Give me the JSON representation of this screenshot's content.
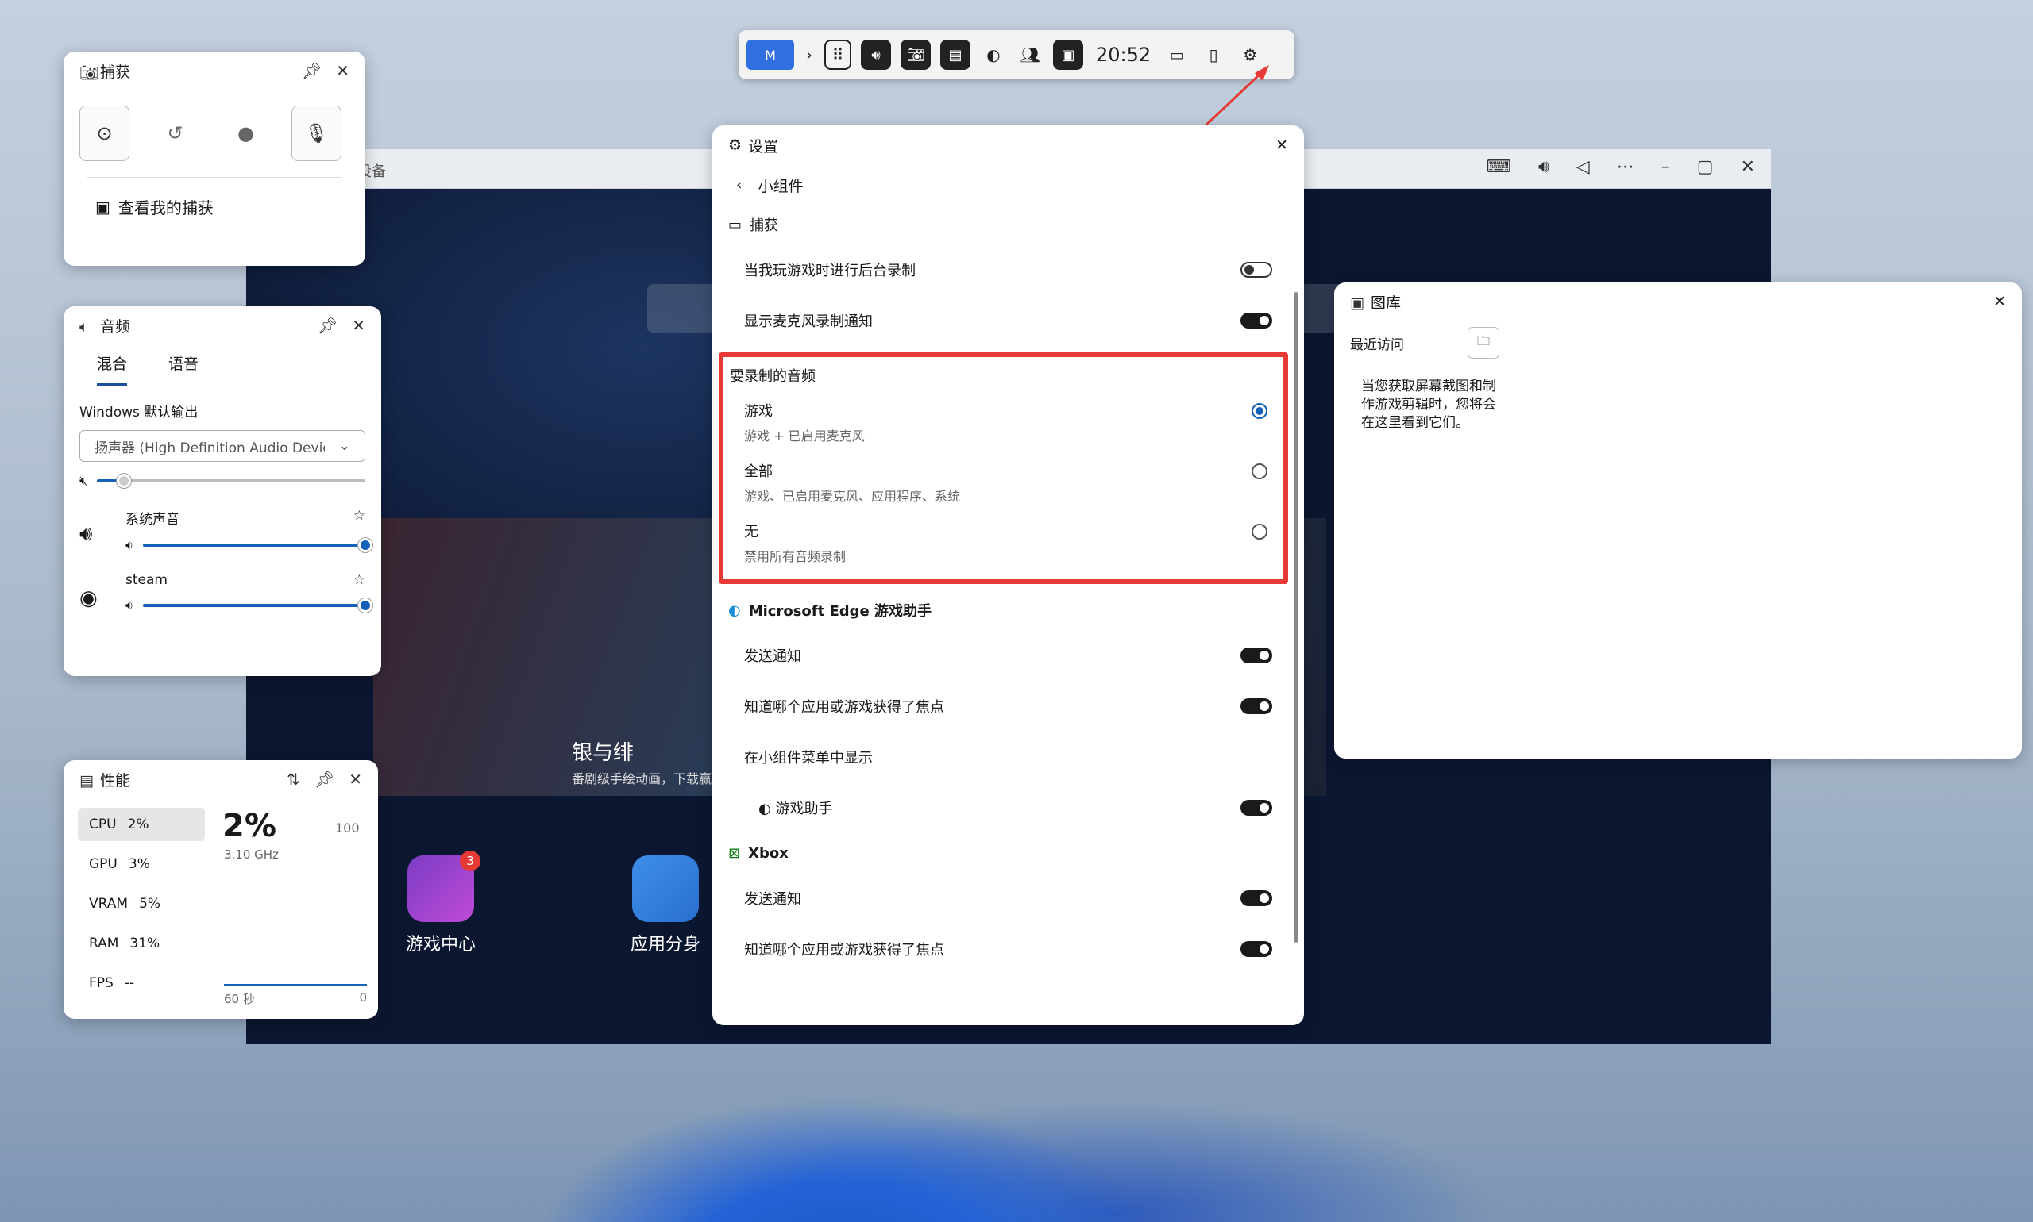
{
  "toolbar": {
    "time": "20:52"
  },
  "emulator": {
    "title": "设备",
    "banner_title": "银与绯",
    "banner_subtitle": "番剧级手绘动画，下载赢金条!",
    "apps": [
      {
        "label": "游戏中心",
        "badge": "3"
      },
      {
        "label": "应用分身"
      }
    ]
  },
  "capture": {
    "title": "捕获",
    "link": "查看我的捕获"
  },
  "audio": {
    "title": "音频",
    "tabs": [
      "混合",
      "语音"
    ],
    "output_label": "Windows 默认输出",
    "device": "扬声器 (High Definition Audio Device)",
    "apps": [
      {
        "name": "系统声音"
      },
      {
        "name": "steam"
      }
    ],
    "master_level": 0.1,
    "system_level": 1.0,
    "steam_level": 1.0
  },
  "performance": {
    "title": "性能",
    "items": [
      {
        "label": "CPU",
        "value": "2%"
      },
      {
        "label": "GPU",
        "value": "3%"
      },
      {
        "label": "VRAM",
        "value": "5%"
      },
      {
        "label": "RAM",
        "value": "31%"
      },
      {
        "label": "FPS",
        "value": "--"
      }
    ],
    "big": "2%",
    "max": "100",
    "freq": "3.10 GHz",
    "axis_left": "60 秒",
    "axis_right": "0"
  },
  "settings": {
    "title": "设置",
    "back_label": "小组件",
    "capture_section": "捕获",
    "bg_record": "当我玩游戏时进行后台录制",
    "mic_notify": "显示麦克风录制通知",
    "audio_title": "要录制的音频",
    "options": [
      {
        "main": "游戏",
        "sub": "游戏 + 已启用麦克风"
      },
      {
        "main": "全部",
        "sub": "游戏、已启用麦克风、应用程序、系统"
      },
      {
        "main": "无",
        "sub": "禁用所有音频录制"
      }
    ],
    "edge_section": "Microsoft Edge 游戏助手",
    "send_notify": "发送通知",
    "focus_notify": "知道哪个应用或游戏获得了焦点",
    "show_in_menu": "在小组件菜单中显示",
    "game_helper": "游戏助手",
    "xbox_section": "Xbox"
  },
  "gallery": {
    "title": "图库",
    "recent": "最近访问",
    "empty_text": "当您获取屏幕截图和制作游戏剪辑时，您将会在这里看到它们。"
  },
  "colors": {
    "accent": "#1561b8",
    "highlight": "#e53935"
  }
}
